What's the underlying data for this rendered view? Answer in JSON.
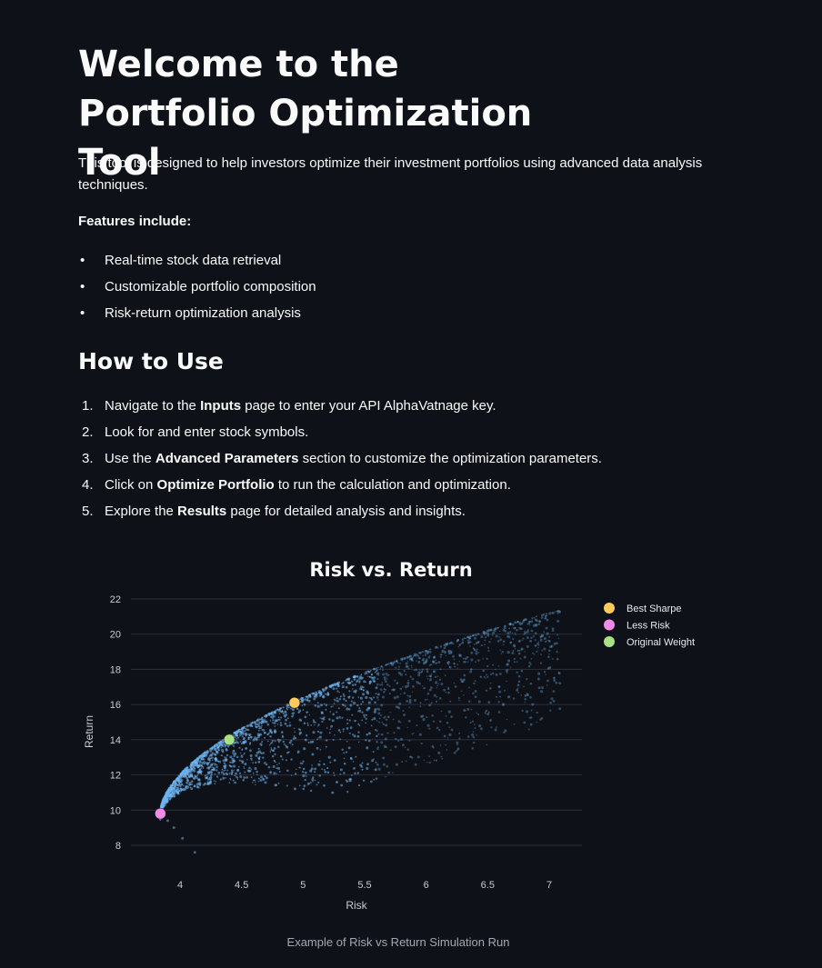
{
  "page": {
    "title": "Welcome to the Portfolio Optimization Tool",
    "intro": "This tool is designed to help investors optimize their investment portfolios using advanced data analysis techniques.",
    "features_title": "Features include:",
    "features": [
      "Real-time stock data retrieval",
      "Customizable portfolio composition",
      "Risk-return optimization analysis"
    ],
    "howto_title": "How to Use",
    "steps": [
      {
        "num": "1.",
        "parts": [
          {
            "t": "Navigate to the "
          },
          {
            "t": "Inputs",
            "b": true
          },
          {
            "t": " page to enter your API AlphaVatnage key."
          }
        ]
      },
      {
        "num": "2.",
        "parts": [
          {
            "t": "Look for and enter stock symbols."
          }
        ]
      },
      {
        "num": "3.",
        "parts": [
          {
            "t": "Use the "
          },
          {
            "t": "Advanced Parameters",
            "b": true
          },
          {
            "t": " section to customize the optimization parameters."
          }
        ]
      },
      {
        "num": "4.",
        "parts": [
          {
            "t": "Click on "
          },
          {
            "t": "Optimize Portfolio",
            "b": true
          },
          {
            "t": " to run the calculation and optimization."
          }
        ]
      },
      {
        "num": "5.",
        "parts": [
          {
            "t": "Explore the "
          },
          {
            "t": "Results",
            "b": true
          },
          {
            "t": " page for detailed analysis and insights."
          }
        ]
      }
    ],
    "caption": "Example of Risk vs Return Simulation Run",
    "bullet_char": "•"
  },
  "chart_data": {
    "type": "scatter",
    "title": "Risk vs. Return",
    "xlabel": "Risk",
    "ylabel": "Return",
    "xlim": [
      3.5,
      7.3
    ],
    "ylim": [
      7.0,
      22.5
    ],
    "xticks": [
      4,
      4.5,
      5,
      5.5,
      6,
      6.5,
      7
    ],
    "yticks": [
      8,
      10,
      12,
      14,
      16,
      18,
      20,
      22
    ],
    "grid": "horizontal",
    "legend_position": "top-right",
    "simulation_cloud": {
      "color": "#6fb6f2",
      "description_points": [
        [
          3.85,
          9.8
        ],
        [
          3.9,
          9.2
        ],
        [
          4.0,
          11.8
        ],
        [
          4.2,
          13.0
        ],
        [
          4.5,
          14.4
        ],
        [
          4.9,
          15.9
        ],
        [
          5.3,
          17.0
        ],
        [
          5.8,
          18.6
        ],
        [
          6.3,
          19.7
        ],
        [
          6.8,
          20.6
        ],
        [
          7.05,
          21.3
        ],
        [
          5.0,
          13.8
        ],
        [
          5.3,
          15.6
        ],
        [
          5.8,
          13.0
        ],
        [
          4.6,
          12.6
        ],
        [
          4.1,
          7.6
        ]
      ]
    },
    "series": [
      {
        "name": "Best Sharpe",
        "color": "#fdca5b",
        "points": [
          [
            4.93,
            16.1
          ]
        ]
      },
      {
        "name": "Less Risk",
        "color": "#f28be8",
        "points": [
          [
            3.84,
            9.8
          ]
        ]
      },
      {
        "name": "Original Weight",
        "color": "#a9e083",
        "points": [
          [
            4.4,
            14.0
          ]
        ]
      }
    ]
  }
}
